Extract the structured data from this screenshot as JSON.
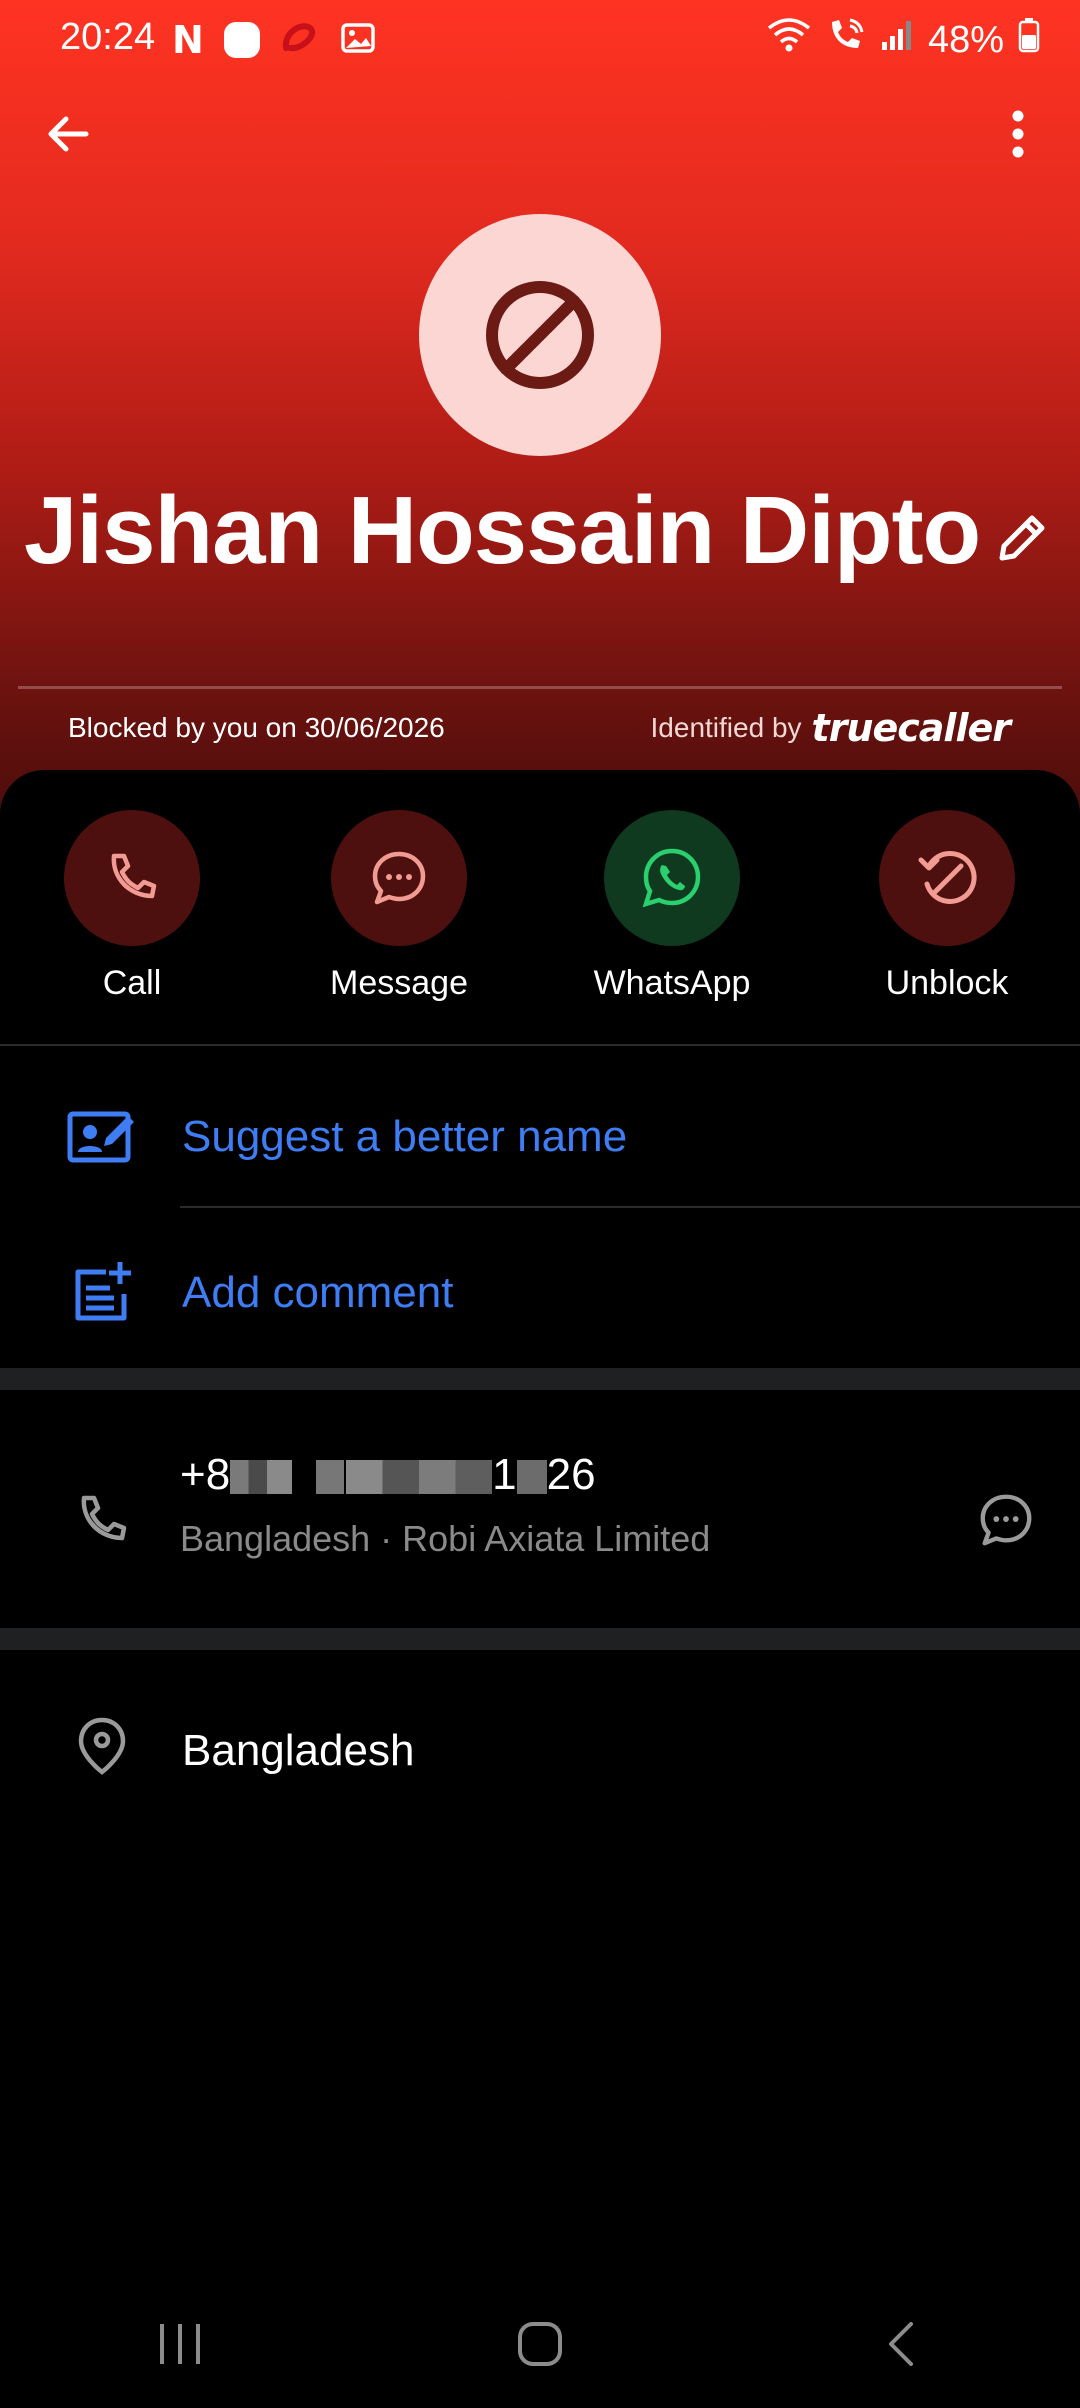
{
  "status_bar": {
    "time": "20:24",
    "battery": "48%",
    "left_icons": [
      "netflix-icon",
      "circle-app-icon",
      "airtel-icon",
      "gallery-icon"
    ],
    "right_icons": [
      "wifi-icon",
      "wifi-call-icon",
      "signal-icon",
      "battery-icon"
    ]
  },
  "contact": {
    "name": "Jishan Hossain Dipto",
    "blocked_info": "Blocked by you on 30/06/2026",
    "identified_by": "Identified by",
    "brand": "truecaller"
  },
  "actions": [
    {
      "label": "Call",
      "icon": "phone-icon"
    },
    {
      "label": "Message",
      "icon": "chat-bubble-icon"
    },
    {
      "label": "WhatsApp",
      "icon": "whatsapp-icon"
    },
    {
      "label": "Unblock",
      "icon": "unblock-icon"
    }
  ],
  "options": {
    "suggest_name": "Suggest a better name",
    "add_comment": "Add comment"
  },
  "phone": {
    "part1": "+8",
    "part2": "1",
    "part3": "26",
    "carrier": "Bangladesh · Robi Axiata Limited"
  },
  "location": {
    "text": "Bangladesh"
  },
  "colors": {
    "header_red": "#ff3322",
    "accent_blue": "#3e7df4",
    "whatsapp_green": "#2ad06d",
    "action_red_bg": "#4d100e",
    "action_red_icon": "#f29b92"
  }
}
